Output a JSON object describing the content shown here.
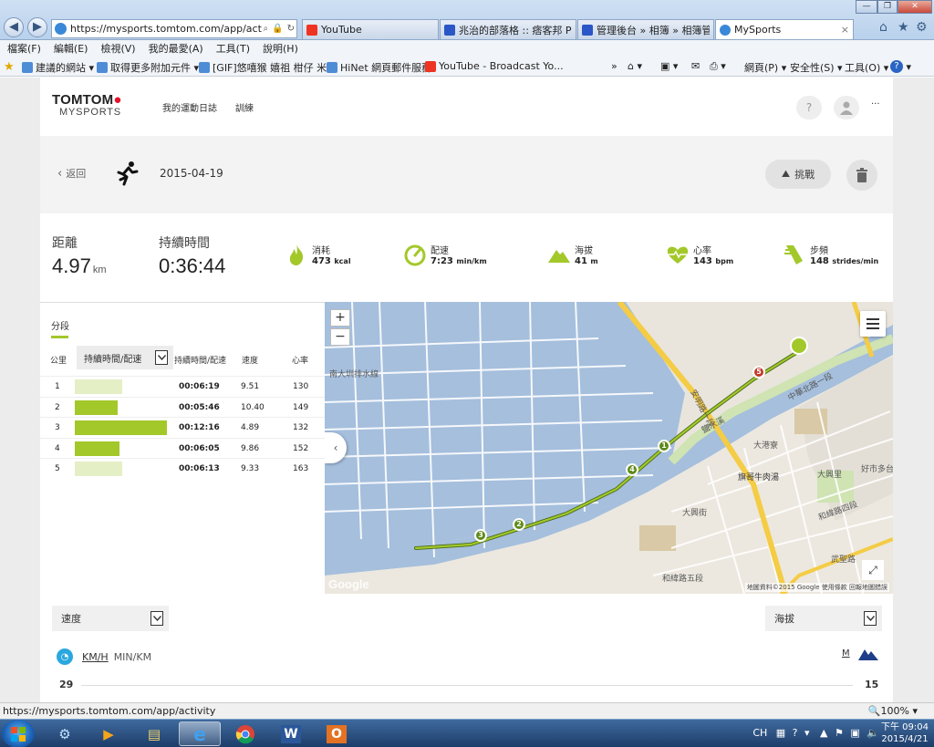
{
  "browser": {
    "address_url": "https://mysports.tomtom.com/app/activity",
    "tabs": [
      {
        "label": "YouTube",
        "color": "#e32"
      },
      {
        "label": "兆治的部落格 :: 痞客邦 PIXN...",
        "color": "#2a56c6"
      },
      {
        "label": "管理後台 » 相簿 » 相簿管理...",
        "color": "#2a56c6"
      },
      {
        "label": "MySports",
        "color": "#3a88d8"
      }
    ],
    "tab_close": "×",
    "menu": [
      "檔案(F)",
      "編輯(E)",
      "檢視(V)",
      "我的最愛(A)",
      "工具(T)",
      "說明(H)"
    ],
    "favorites": [
      {
        "label": "建議的網站 ▾",
        "color": "#4e8cd6"
      },
      {
        "label": "取得更多附加元件 ▾",
        "color": "#4e8cd6"
      },
      {
        "label": "[GIF]悠嘻猴 嬉祖 柑仔 米...",
        "color": "#4e8cd6"
      },
      {
        "label": "HiNet 網頁郵件服務",
        "color": "#4e8cd6"
      },
      {
        "label": "YouTube - Broadcast Yo...",
        "color": "#e32"
      }
    ],
    "commandbar": [
      "網頁(P) ▾",
      "安全性(S) ▾",
      "工具(O) ▾"
    ],
    "status_url": "https://mysports.tomtom.com/app/activity",
    "zoom_label": "🔍100%  ▾"
  },
  "site": {
    "logo_top": "TOMTOM",
    "logo_bottom": "MYSPORTS",
    "nav": [
      "我的運動日誌",
      "訓練"
    ],
    "more": "···"
  },
  "activity": {
    "back_label": "返回",
    "date": "2015-04-19",
    "challenge_label": "挑戰",
    "distance_label": "距離",
    "distance_value": "4.97",
    "distance_unit": "km",
    "duration_label": "持續時間",
    "duration_value": "0:36:44",
    "metrics": [
      {
        "label": "消耗",
        "value": "473",
        "unit": "kcal",
        "icon": "flame-icon"
      },
      {
        "label": "配速",
        "value": "7:23",
        "unit": "min/km",
        "icon": "pace-gauge-icon"
      },
      {
        "label": "海拔",
        "value": "41",
        "unit": "m",
        "icon": "mountain-icon"
      },
      {
        "label": "心率",
        "value": "143",
        "unit": "bpm",
        "icon": "heart-rate-icon"
      },
      {
        "label": "步頻",
        "value": "148",
        "unit": "strides/min",
        "icon": "cadence-icon"
      }
    ],
    "accent_color": "#a3c82a"
  },
  "splits": {
    "tab_label": "分段",
    "headers": {
      "km": "公里",
      "select": "持續時間/配速",
      "duration": "持續時間/配速",
      "speed": "速度",
      "hr": "心率"
    },
    "rows": [
      {
        "km": "1",
        "duration": "00:06:19",
        "speed": "9.51",
        "hr": "130",
        "bar_fraction": 0.51
      },
      {
        "km": "2",
        "duration": "00:05:46",
        "speed": "10.40",
        "hr": "149",
        "bar_fraction": 0.47
      },
      {
        "km": "3",
        "duration": "00:12:16",
        "speed": "4.89",
        "hr": "132",
        "bar_fraction": 1.0
      },
      {
        "km": "4",
        "duration": "00:06:05",
        "speed": "9.86",
        "hr": "152",
        "bar_fraction": 0.49
      },
      {
        "km": "5",
        "duration": "00:06:13",
        "speed": "9.33",
        "hr": "163",
        "bar_fraction": 0.51
      }
    ]
  },
  "map": {
    "zoom_in": "+",
    "zoom_out": "−",
    "google_label": "Google",
    "attribution": "地圖資料©2015 Google  使用條款  回報地圖錯誤",
    "labels": [
      {
        "text": "南大圳排水線"
      },
      {
        "text": "旗哥牛肉湯"
      },
      {
        "text": "大興街"
      },
      {
        "text": "大興里"
      },
      {
        "text": "和緯路四段"
      },
      {
        "text": "和緯路五段"
      },
      {
        "text": "中華北路一段"
      },
      {
        "text": "武聖路"
      },
      {
        "text": "安明路一段"
      },
      {
        "text": "好市多台"
      },
      {
        "text": "大港寮"
      },
      {
        "text": "鹽水溪"
      }
    ],
    "markers": [
      "1",
      "2",
      "3",
      "4",
      "5"
    ]
  },
  "chart": {
    "left_dropdown": "速度",
    "right_dropdown": "海拔",
    "unit_active": "KM/H",
    "unit_alt": "MIN/KM",
    "right_unit": "M",
    "left_value": "29",
    "right_value": "15"
  },
  "taskbar": {
    "apps": [
      "ie-icon",
      "media-player-icon",
      "explorer-icon",
      "internet-explorer-icon",
      "chrome-icon",
      "word-icon",
      "outlook-icon"
    ],
    "tray_lang": "CH",
    "time": "下午 09:04",
    "date": "2015/4/21"
  }
}
